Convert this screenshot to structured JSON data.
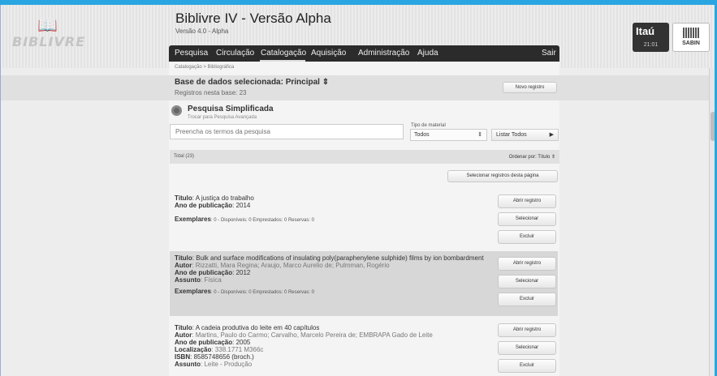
{
  "header": {
    "logo_text": "BIBLIVRE",
    "title": "Biblivre IV - Versão Alpha",
    "subtitle": "Versão 4.0 - Alpha",
    "nav": [
      "Pesquisa",
      "Circulação",
      "Catalogação",
      "Aquisição",
      "Administração",
      "Ajuda"
    ],
    "logout": "Sair",
    "sponsor1": "Itaú",
    "clock": "21:01",
    "sponsor2": "SABIN"
  },
  "breadcrumb": "Catalogação > Bibliográfica",
  "database": {
    "title": "Base de dados selecionada:  Principal ⇕",
    "count": "Registros nesta base: 23",
    "new_record": "Novo registro"
  },
  "search": {
    "title": "Pesquisa Simplificada",
    "switch": "Trocar para Pesquisa Avançada",
    "placeholder": "Preencha os termos da pesquisa",
    "type_label": "Tipo de material",
    "type_value": "Todos",
    "list_all": "Listar Todos"
  },
  "results_bar": {
    "total": "Total  (23)",
    "sort": "Ordenar por:  Título ⇕",
    "select_page": "Selecionar registros desta página"
  },
  "actions": {
    "open": "Abrir registro",
    "select": "Selecionar",
    "delete": "Excluir"
  },
  "labels": {
    "title": "Título",
    "author": "Autor",
    "year": "Ano de publicação",
    "location": "Localização",
    "isbn": "ISBN",
    "subject": "Assunto",
    "copies": "Exemplares"
  },
  "results": [
    {
      "title": ": A justiça do trabalho",
      "year": ": 2014",
      "copies": ": 0 - ",
      "copies_detail": "Disponíveis: 0  Emprestados: 0  Reservas: 0"
    },
    {
      "title": ": Bulk and surface modifications of insulating poly(paraphenylene sulphide) films by ion bombardment",
      "author": ": Rizzatti, Mara Regina; Araujo, Marco Aurelio de; Pulmman, Rogério",
      "year": ": 2012",
      "subject": ": Física",
      "copies": ": 0 - ",
      "copies_detail": "Disponíveis: 0  Emprestados: 0  Reservas: 0"
    },
    {
      "title": ": A cadeia produtiva do leite em 40 capítulos",
      "author": ": Martins, Paulo do Carmo; Carvalho, Marcelo Pereira de; EMBRAPA Gado de Leite",
      "year": ": 2005",
      "location": ": 338.1771 M366c",
      "isbn": ": 8585748656 (broch.)",
      "subject": ": Leite - Produção"
    }
  ]
}
